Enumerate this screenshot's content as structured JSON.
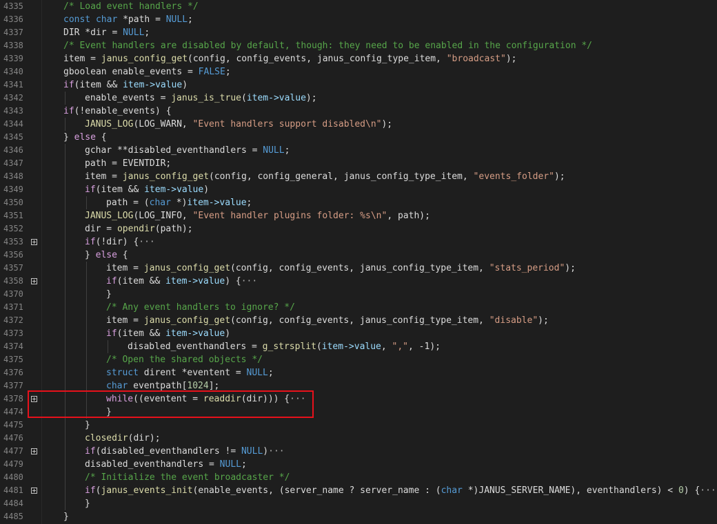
{
  "editor": {
    "lines": [
      {
        "n": "4335",
        "indent": 0,
        "fold": false,
        "tokens": [
          {
            "t": "/* Load event handlers */",
            "c": "cmt"
          }
        ]
      },
      {
        "n": "4336",
        "indent": 0,
        "fold": false,
        "tokens": [
          {
            "t": "const ",
            "c": "kw"
          },
          {
            "t": "char",
            "c": "kw"
          },
          {
            "t": " *path = ",
            "c": "pl"
          },
          {
            "t": "NULL",
            "c": "kw"
          },
          {
            "t": ";",
            "c": "pl"
          }
        ]
      },
      {
        "n": "4337",
        "indent": 0,
        "fold": false,
        "tokens": [
          {
            "t": "DIR *dir = ",
            "c": "pl"
          },
          {
            "t": "NULL",
            "c": "kw"
          },
          {
            "t": ";",
            "c": "pl"
          }
        ]
      },
      {
        "n": "4338",
        "indent": 0,
        "fold": false,
        "tokens": [
          {
            "t": "/* Event handlers are disabled by default, though: they need to be enabled in the configuration */",
            "c": "cmt"
          }
        ]
      },
      {
        "n": "4339",
        "indent": 0,
        "fold": false,
        "tokens": [
          {
            "t": "item = ",
            "c": "pl"
          },
          {
            "t": "janus_config_get",
            "c": "fn"
          },
          {
            "t": "(config, config_events, janus_config_type_item, ",
            "c": "pl"
          },
          {
            "t": "\"broadcast\"",
            "c": "str"
          },
          {
            "t": ");",
            "c": "pl"
          }
        ]
      },
      {
        "n": "4340",
        "indent": 0,
        "fold": false,
        "tokens": [
          {
            "t": "gboolean enable_events = ",
            "c": "pl"
          },
          {
            "t": "FALSE",
            "c": "kw"
          },
          {
            "t": ";",
            "c": "pl"
          }
        ]
      },
      {
        "n": "4341",
        "indent": 0,
        "fold": false,
        "tokens": [
          {
            "t": "if",
            "c": "ctl"
          },
          {
            "t": "(item && ",
            "c": "pl"
          },
          {
            "t": "item->value",
            "c": "fld"
          },
          {
            "t": ")",
            "c": "pl"
          }
        ]
      },
      {
        "n": "4342",
        "indent": 1,
        "fold": false,
        "tokens": [
          {
            "t": "enable_events = ",
            "c": "pl"
          },
          {
            "t": "janus_is_true",
            "c": "fn"
          },
          {
            "t": "(",
            "c": "pl"
          },
          {
            "t": "item->value",
            "c": "fld"
          },
          {
            "t": ");",
            "c": "pl"
          }
        ]
      },
      {
        "n": "4343",
        "indent": 0,
        "fold": false,
        "tokens": [
          {
            "t": "if",
            "c": "ctl"
          },
          {
            "t": "(!enable_events) {",
            "c": "pl"
          }
        ]
      },
      {
        "n": "4344",
        "indent": 1,
        "fold": false,
        "tokens": [
          {
            "t": "JANUS_LOG",
            "c": "fn"
          },
          {
            "t": "(LOG_WARN, ",
            "c": "pl"
          },
          {
            "t": "\"Event handlers support disabled\\n\"",
            "c": "str"
          },
          {
            "t": ");",
            "c": "pl"
          }
        ]
      },
      {
        "n": "4345",
        "indent": 0,
        "fold": false,
        "tokens": [
          {
            "t": "} ",
            "c": "pl"
          },
          {
            "t": "else",
            "c": "ctl"
          },
          {
            "t": " {",
            "c": "pl"
          }
        ]
      },
      {
        "n": "4346",
        "indent": 1,
        "fold": false,
        "tokens": [
          {
            "t": "gchar **disabled_eventhandlers = ",
            "c": "pl"
          },
          {
            "t": "NULL",
            "c": "kw"
          },
          {
            "t": ";",
            "c": "pl"
          }
        ]
      },
      {
        "n": "4347",
        "indent": 1,
        "fold": false,
        "tokens": [
          {
            "t": "path = EVENTDIR;",
            "c": "pl"
          }
        ]
      },
      {
        "n": "4348",
        "indent": 1,
        "fold": false,
        "tokens": [
          {
            "t": "item = ",
            "c": "pl"
          },
          {
            "t": "janus_config_get",
            "c": "fn"
          },
          {
            "t": "(config, config_general, janus_config_type_item, ",
            "c": "pl"
          },
          {
            "t": "\"events_folder\"",
            "c": "str"
          },
          {
            "t": ");",
            "c": "pl"
          }
        ]
      },
      {
        "n": "4349",
        "indent": 1,
        "fold": false,
        "tokens": [
          {
            "t": "if",
            "c": "ctl"
          },
          {
            "t": "(item && ",
            "c": "pl"
          },
          {
            "t": "item->value",
            "c": "fld"
          },
          {
            "t": ")",
            "c": "pl"
          }
        ]
      },
      {
        "n": "4350",
        "indent": 2,
        "fold": false,
        "tokens": [
          {
            "t": "path = (",
            "c": "pl"
          },
          {
            "t": "char",
            "c": "kw"
          },
          {
            "t": " *)",
            "c": "pl"
          },
          {
            "t": "item->value",
            "c": "fld"
          },
          {
            "t": ";",
            "c": "pl"
          }
        ]
      },
      {
        "n": "4351",
        "indent": 1,
        "fold": false,
        "tokens": [
          {
            "t": "JANUS_LOG",
            "c": "fn"
          },
          {
            "t": "(LOG_INFO, ",
            "c": "pl"
          },
          {
            "t": "\"Event handler plugins folder: %s\\n\"",
            "c": "str"
          },
          {
            "t": ", path);",
            "c": "pl"
          }
        ]
      },
      {
        "n": "4352",
        "indent": 1,
        "fold": false,
        "tokens": [
          {
            "t": "dir = ",
            "c": "pl"
          },
          {
            "t": "opendir",
            "c": "fn"
          },
          {
            "t": "(path);",
            "c": "pl"
          }
        ]
      },
      {
        "n": "4353",
        "indent": 1,
        "fold": true,
        "tokens": [
          {
            "t": "if",
            "c": "ctl"
          },
          {
            "t": "(!dir) {",
            "c": "pl"
          },
          {
            "t": "···",
            "c": "ell"
          }
        ]
      },
      {
        "n": "4356",
        "indent": 1,
        "fold": false,
        "tokens": [
          {
            "t": "} ",
            "c": "pl"
          },
          {
            "t": "else",
            "c": "ctl"
          },
          {
            "t": " {",
            "c": "pl"
          }
        ]
      },
      {
        "n": "4357",
        "indent": 2,
        "fold": false,
        "tokens": [
          {
            "t": "item = ",
            "c": "pl"
          },
          {
            "t": "janus_config_get",
            "c": "fn"
          },
          {
            "t": "(config, config_events, janus_config_type_item, ",
            "c": "pl"
          },
          {
            "t": "\"stats_period\"",
            "c": "str"
          },
          {
            "t": ");",
            "c": "pl"
          }
        ]
      },
      {
        "n": "4358",
        "indent": 2,
        "fold": true,
        "tokens": [
          {
            "t": "if",
            "c": "ctl"
          },
          {
            "t": "(item && ",
            "c": "pl"
          },
          {
            "t": "item->value",
            "c": "fld"
          },
          {
            "t": ") {",
            "c": "pl"
          },
          {
            "t": "···",
            "c": "ell"
          }
        ]
      },
      {
        "n": "4370",
        "indent": 2,
        "fold": false,
        "tokens": [
          {
            "t": "}",
            "c": "pl"
          }
        ]
      },
      {
        "n": "4371",
        "indent": 2,
        "fold": false,
        "tokens": [
          {
            "t": "/* Any event handlers to ignore? */",
            "c": "cmt"
          }
        ]
      },
      {
        "n": "4372",
        "indent": 2,
        "fold": false,
        "tokens": [
          {
            "t": "item = ",
            "c": "pl"
          },
          {
            "t": "janus_config_get",
            "c": "fn"
          },
          {
            "t": "(config, config_events, janus_config_type_item, ",
            "c": "pl"
          },
          {
            "t": "\"disable\"",
            "c": "str"
          },
          {
            "t": ");",
            "c": "pl"
          }
        ]
      },
      {
        "n": "4373",
        "indent": 2,
        "fold": false,
        "tokens": [
          {
            "t": "if",
            "c": "ctl"
          },
          {
            "t": "(item && ",
            "c": "pl"
          },
          {
            "t": "item->value",
            "c": "fld"
          },
          {
            "t": ")",
            "c": "pl"
          }
        ]
      },
      {
        "n": "4374",
        "indent": 3,
        "fold": false,
        "tokens": [
          {
            "t": "disabled_eventhandlers = ",
            "c": "pl"
          },
          {
            "t": "g_strsplit",
            "c": "fn"
          },
          {
            "t": "(",
            "c": "pl"
          },
          {
            "t": "item->value",
            "c": "fld"
          },
          {
            "t": ", ",
            "c": "pl"
          },
          {
            "t": "\",\"",
            "c": "str"
          },
          {
            "t": ", -1);",
            "c": "pl"
          }
        ]
      },
      {
        "n": "4375",
        "indent": 2,
        "fold": false,
        "tokens": [
          {
            "t": "/* Open the shared objects */",
            "c": "cmt"
          }
        ]
      },
      {
        "n": "4376",
        "indent": 2,
        "fold": false,
        "tokens": [
          {
            "t": "struct",
            "c": "kw"
          },
          {
            "t": " dirent *eventent = ",
            "c": "pl"
          },
          {
            "t": "NULL",
            "c": "kw"
          },
          {
            "t": ";",
            "c": "pl"
          }
        ]
      },
      {
        "n": "4377",
        "indent": 2,
        "fold": false,
        "tokens": [
          {
            "t": "char",
            "c": "kw"
          },
          {
            "t": " eventpath[",
            "c": "pl"
          },
          {
            "t": "1024",
            "c": "num"
          },
          {
            "t": "];",
            "c": "pl"
          }
        ]
      },
      {
        "n": "4378",
        "indent": 2,
        "fold": true,
        "tokens": [
          {
            "t": "while",
            "c": "ctl"
          },
          {
            "t": "((eventent = ",
            "c": "pl"
          },
          {
            "t": "readdir",
            "c": "fn"
          },
          {
            "t": "(dir))) {",
            "c": "pl"
          },
          {
            "t": "···",
            "c": "ell"
          }
        ]
      },
      {
        "n": "4474",
        "indent": 2,
        "fold": false,
        "tokens": [
          {
            "t": "}",
            "c": "pl"
          }
        ]
      },
      {
        "n": "4475",
        "indent": 1,
        "fold": false,
        "tokens": [
          {
            "t": "}",
            "c": "pl"
          }
        ]
      },
      {
        "n": "4476",
        "indent": 1,
        "fold": false,
        "tokens": [
          {
            "t": "closedir",
            "c": "fn"
          },
          {
            "t": "(dir);",
            "c": "pl"
          }
        ]
      },
      {
        "n": "4477",
        "indent": 1,
        "fold": true,
        "tokens": [
          {
            "t": "if",
            "c": "ctl"
          },
          {
            "t": "(disabled_eventhandlers != ",
            "c": "pl"
          },
          {
            "t": "NULL",
            "c": "kw"
          },
          {
            "t": ")",
            "c": "pl"
          },
          {
            "t": "···",
            "c": "ell"
          }
        ]
      },
      {
        "n": "4479",
        "indent": 1,
        "fold": false,
        "tokens": [
          {
            "t": "disabled_eventhandlers = ",
            "c": "pl"
          },
          {
            "t": "NULL",
            "c": "kw"
          },
          {
            "t": ";",
            "c": "pl"
          }
        ]
      },
      {
        "n": "4480",
        "indent": 1,
        "fold": false,
        "tokens": [
          {
            "t": "/* Initialize the event broadcaster */",
            "c": "cmt"
          }
        ]
      },
      {
        "n": "4481",
        "indent": 1,
        "fold": true,
        "tokens": [
          {
            "t": "if",
            "c": "ctl"
          },
          {
            "t": "(",
            "c": "pl"
          },
          {
            "t": "janus_events_init",
            "c": "fn"
          },
          {
            "t": "(enable_events, (server_name ? server_name : (",
            "c": "pl"
          },
          {
            "t": "char",
            "c": "kw"
          },
          {
            "t": " *)JANUS_SERVER_NAME), eventhandlers) < ",
            "c": "pl"
          },
          {
            "t": "0",
            "c": "num"
          },
          {
            "t": ") {",
            "c": "pl"
          },
          {
            "t": "···",
            "c": "ell"
          }
        ]
      },
      {
        "n": "4484",
        "indent": 1,
        "fold": false,
        "tokens": [
          {
            "t": "}",
            "c": "pl"
          }
        ]
      },
      {
        "n": "4485",
        "indent": 0,
        "fold": false,
        "tokens": [
          {
            "t": "}",
            "c": "pl"
          }
        ]
      }
    ]
  },
  "colors": {
    "background": "#1e1e1e",
    "highlight_box": "#e8111b"
  }
}
